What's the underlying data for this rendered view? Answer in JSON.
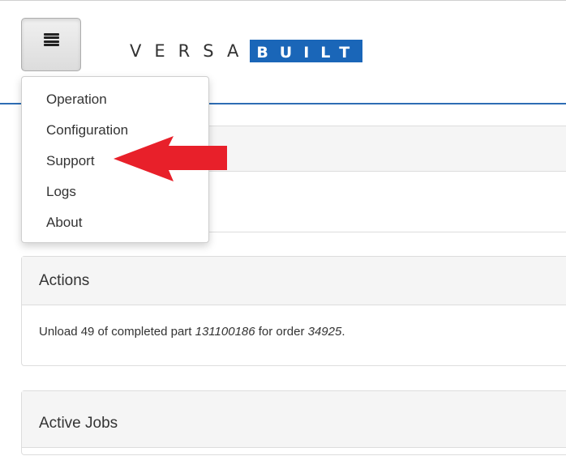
{
  "navbar": {
    "brand_left": "VERSA",
    "brand_right": "BUILT",
    "brand_color": "#1a66b8"
  },
  "dropdown": {
    "items": [
      {
        "label": "Operation"
      },
      {
        "label": "Configuration"
      },
      {
        "label": "Support"
      },
      {
        "label": "Logs"
      },
      {
        "label": "About"
      }
    ]
  },
  "actions": {
    "title": "Actions",
    "text_prefix": "Unload 49 of completed part ",
    "part_number": "131100186",
    "text_middle": " for order ",
    "order_number": "34925",
    "text_suffix": "."
  },
  "active_jobs": {
    "title": "Active Jobs"
  },
  "annotation": {
    "arrow_color": "#e8202a",
    "icon": "red-arrow-pointing-left"
  }
}
